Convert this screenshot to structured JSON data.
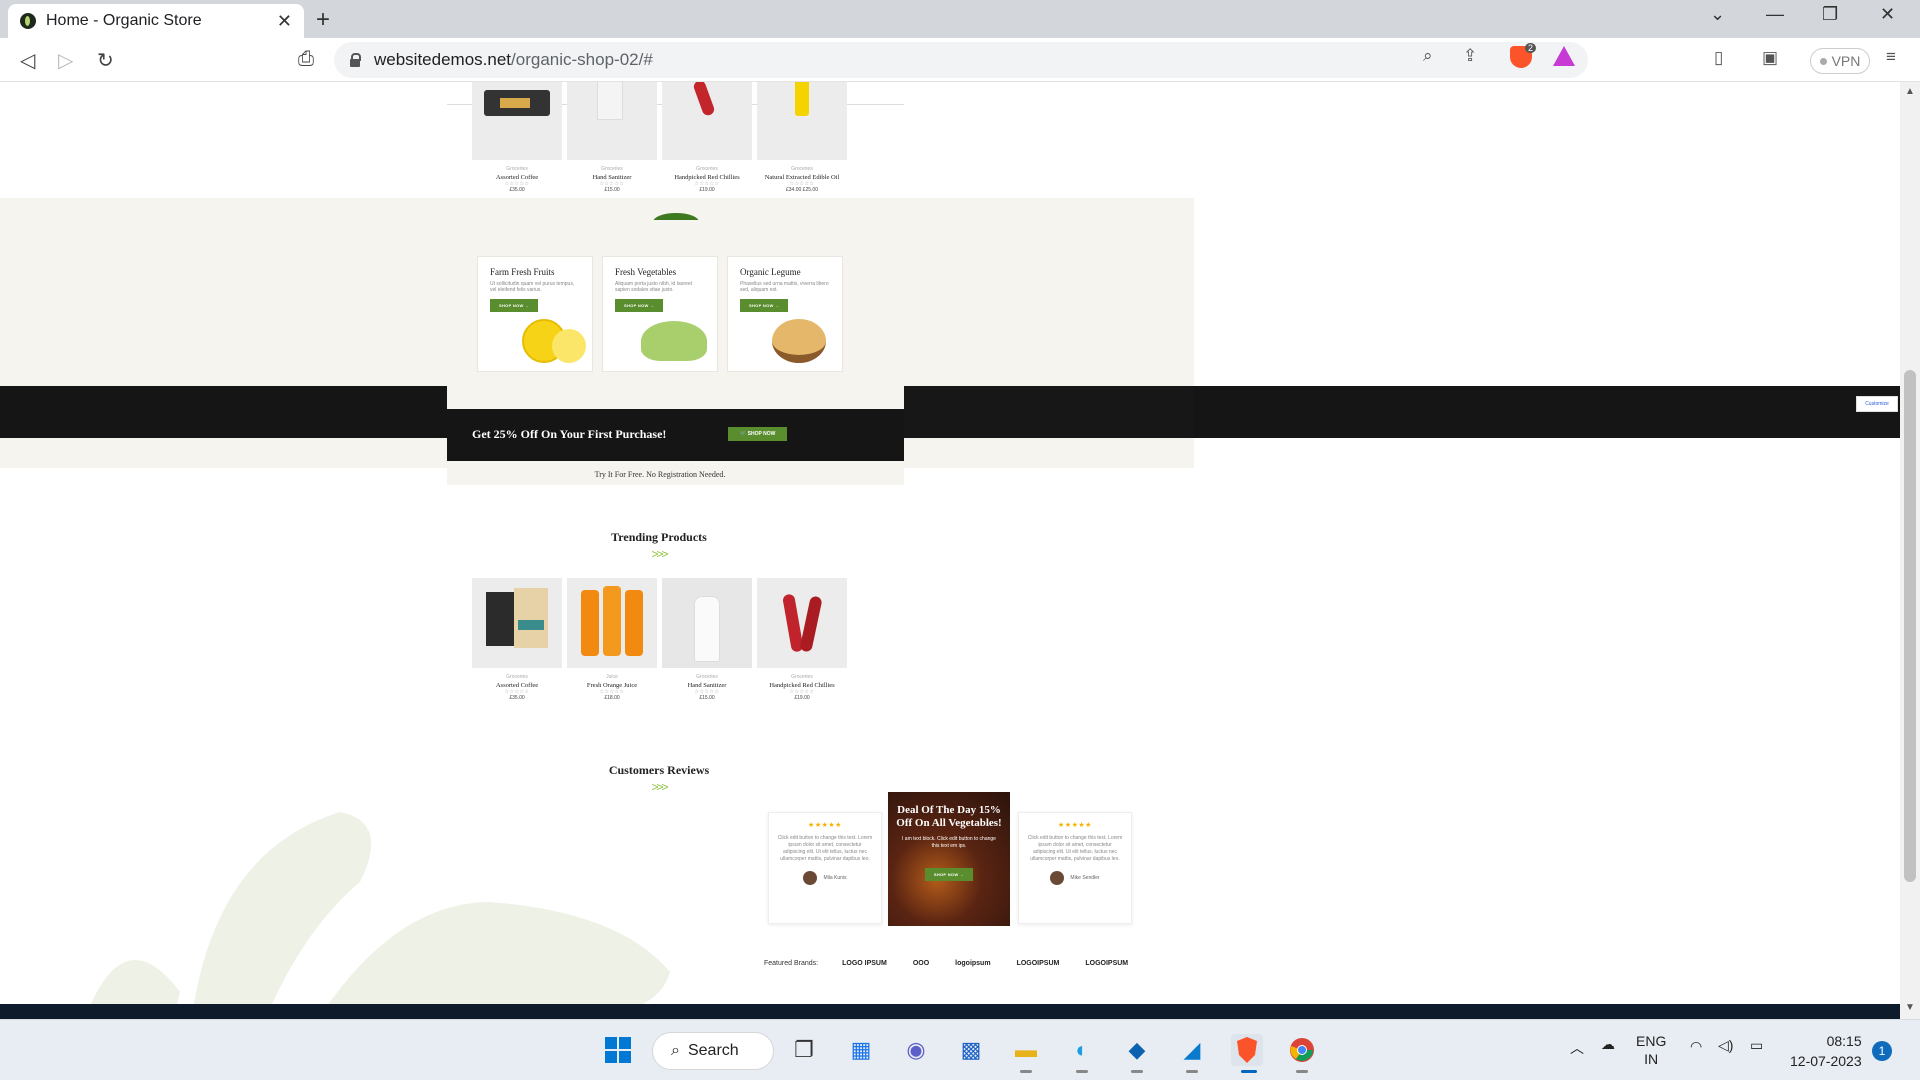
{
  "browser": {
    "tab_title": "Home - Organic Store",
    "new_tab": "+",
    "url_host": "websitedemos.net",
    "url_path": "/organic-shop-02/#",
    "brave_count": "2",
    "vpn_label": "VPN"
  },
  "top_products": [
    {
      "category": "Groceries",
      "name": "Assorted Coffee",
      "stars": "☆☆☆☆☆",
      "price": "£35.00"
    },
    {
      "category": "Groceries",
      "name": "Hand Sanitizer",
      "stars": "☆☆☆☆☆",
      "price": "£15.00"
    },
    {
      "category": "Groceries",
      "name": "Handpicked Red Chillies",
      "stars": "☆☆☆☆☆",
      "price": "£19.00"
    },
    {
      "category": "Groceries",
      "name": "Natural Extracted Edible Oil",
      "stars": "☆☆☆☆☆",
      "price": "£34.00 £25.00"
    }
  ],
  "categories": [
    {
      "title": "Farm Fresh Fruits",
      "desc": "Ut sollicitudin quam vel purus tempus, vel eleifend felis varius.",
      "button": "SHOP NOW →"
    },
    {
      "title": "Fresh Vegetables",
      "desc": "Aliquam porta justo nibh, id laoreet sapien sodales vitae justo.",
      "button": "SHOP NOW →"
    },
    {
      "title": "Organic Legume",
      "desc": "Phasellus sed urna mattis, viverra libero sed, aliquam est.",
      "button": "SHOP NOW →"
    }
  ],
  "promo": {
    "title": "Get 25% Off On Your First Purchase!",
    "button": "SHOP NOW",
    "subtitle": "Try It For Free. No Registration Needed.",
    "customize": "Customize"
  },
  "trending": {
    "title": "Trending Products",
    "arrows": ">>>",
    "items": [
      {
        "category": "Groceries",
        "name": "Assorted Coffee",
        "stars": "☆☆☆☆☆",
        "price": "£35.00"
      },
      {
        "category": "Juice",
        "name": "Fresh Orange Juice",
        "stars": "☆☆☆☆☆",
        "price": "£18.00"
      },
      {
        "category": "Groceries",
        "name": "Hand Sanitizer",
        "stars": "☆☆☆☆☆",
        "price": "£15.00"
      },
      {
        "category": "Groceries",
        "name": "Handpicked Red Chillies",
        "stars": "☆☆☆☆☆",
        "price": "£19.00"
      }
    ]
  },
  "reviews": {
    "title": "Customers Reviews",
    "arrows": ">>>",
    "cards": [
      {
        "stars": "★★★★★",
        "text": "Click edit button to change this text. Lorem ipsum dolor sit amet, consectetur adipiscing elit. Ut elit tellus, luctus nec ullamcorper mattis, pulvinar dapibus leo.",
        "name": "Mila Kunis"
      },
      {
        "stars": "★★★★★",
        "text": "Click edit button to change this text. Lorem ipsum dolor sit amet, consectetur adipiscing elit. Ut elit tellus, luctus nec ullamcorper mattis, pulvinar dapibus leo.",
        "name": "Mike Sendler"
      }
    ],
    "deal": {
      "title": "Deal Of The Day 15% Off On All Vegetables!",
      "subtitle": "I am text block. Click edit button to change this text em ips.",
      "button": "SHOP NOW →"
    }
  },
  "brands": {
    "label": "Featured Brands:",
    "logos": [
      "LOGO IPSUM",
      "OOO",
      "logoipsum",
      "LOGOIPSUM",
      "LOGOIPSUM"
    ]
  },
  "taskbar": {
    "search_label": "Search",
    "lang": "ENG",
    "region": "IN",
    "time": "08:15",
    "date": "12-07-2023",
    "notifications": "1"
  }
}
